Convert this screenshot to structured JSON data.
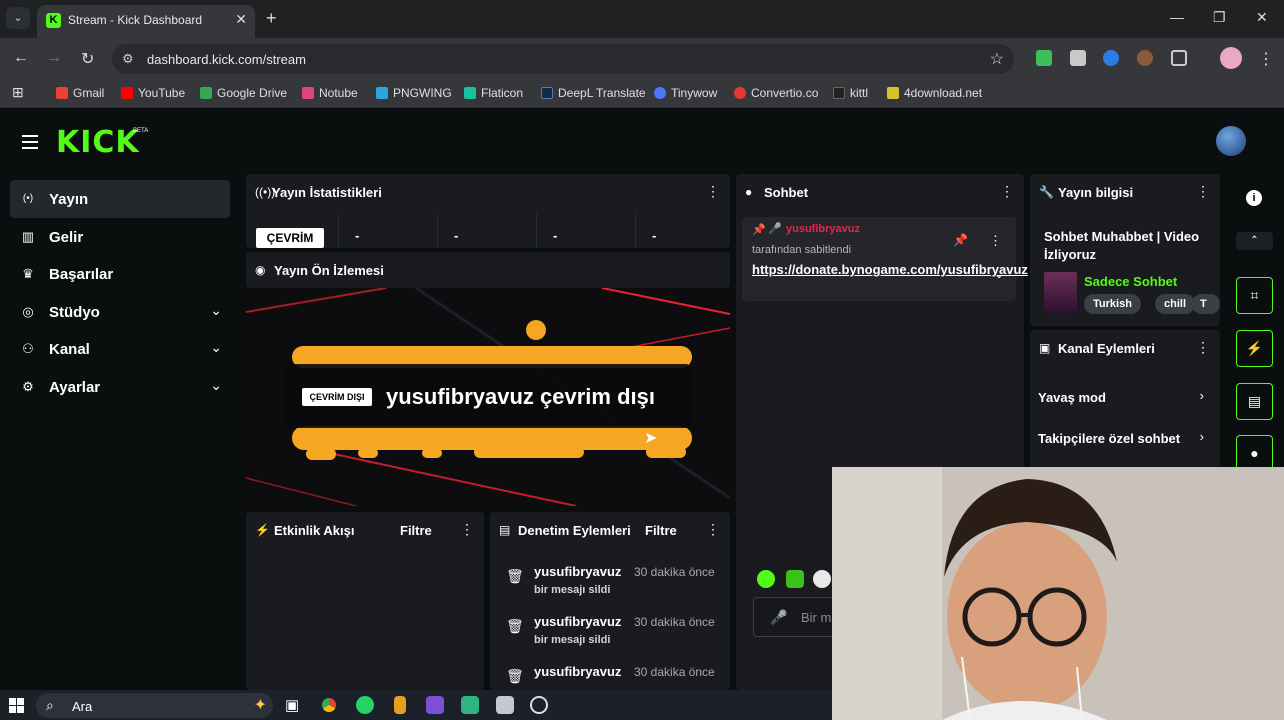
{
  "browser": {
    "tab_title": "Stream - Kick Dashboard",
    "favicon_letter": "K",
    "url": "dashboard.kick.com/stream",
    "bookmarks": [
      {
        "label": "Gmail",
        "color": "#ea4335"
      },
      {
        "label": "YouTube",
        "color": "#ff0000"
      },
      {
        "label": "Google Drive",
        "color": "#34a853"
      },
      {
        "label": "Notube",
        "color": "#e0457b"
      },
      {
        "label": "PNGWING",
        "color": "#2aa7e1"
      },
      {
        "label": "Flaticon",
        "color": "#14c3a2"
      },
      {
        "label": "DeepL Translate",
        "color": "#0f2b46"
      },
      {
        "label": "Tinywow",
        "color": "#4f74ff"
      },
      {
        "label": "Convertio.co",
        "color": "#e53935"
      },
      {
        "label": "kittl",
        "color": "#222222"
      },
      {
        "label": "4download.net",
        "color": "#d4c42b"
      }
    ]
  },
  "header": {
    "logo": "KICK",
    "logo_badge": "BETA"
  },
  "sidebar": {
    "items": [
      {
        "label": "Yayın",
        "icon": "broadcast-icon",
        "glyph": "(•)"
      },
      {
        "label": "Gelir",
        "icon": "chart-icon",
        "glyph": "▥"
      },
      {
        "label": "Başarılar",
        "icon": "trophy-icon",
        "glyph": "♛"
      },
      {
        "label": "Stüdyo",
        "icon": "studio-icon",
        "glyph": "◎"
      },
      {
        "label": "Kanal",
        "icon": "users-icon",
        "glyph": "⚇"
      },
      {
        "label": "Ayarlar",
        "icon": "gear-icon",
        "glyph": "⚙"
      }
    ]
  },
  "stats": {
    "title": "Yayın İstatistikleri",
    "status": "ÇEVRİM",
    "values": [
      "-",
      "-",
      "-",
      "-"
    ]
  },
  "preview": {
    "title": "Yayın Ön İzlemesi",
    "offline_tag": "ÇEVRİM DIŞI",
    "offline_text": "yusufibryavuz çevrim dışı"
  },
  "activity": {
    "title": "Etkinlik Akışı",
    "filter": "Filtre"
  },
  "moderation": {
    "title": "Denetim Eylemleri",
    "filter": "Filtre",
    "entries": [
      {
        "user": "yusufibryavuz",
        "time": "30 dakika önce",
        "action": "bir mesajı sildi"
      },
      {
        "user": "yusufibryavuz",
        "time": "30 dakika önce",
        "action": "bir mesajı sildi"
      },
      {
        "user": "yusufibryavuz",
        "time": "30 dakika önce",
        "action": ""
      }
    ]
  },
  "chat": {
    "title": "Sohbet",
    "pinned_user": "yusufibryavuz",
    "pinned_by": "tarafından sabitlendi",
    "pinned_link": "https://donate.bynogame.com/yusufibryavuz",
    "input_placeholder": "Bir m"
  },
  "stream_info": {
    "title": "Yayın bilgisi",
    "stream_title": "Sohbet Muhabbet | Video İzliyoruz",
    "category": "Sadece Sohbet",
    "tags": [
      "Turkish",
      "chill",
      "T"
    ]
  },
  "channel_actions": {
    "title": "Kanal Eylemleri",
    "items": [
      "Yavaş mod",
      "Takipçilere özel sohbet"
    ]
  },
  "taskbar": {
    "search_placeholder": "Ara"
  },
  "colors": {
    "brand": "#53fc18",
    "panel": "#191b1f",
    "background": "#0b0e0f"
  }
}
